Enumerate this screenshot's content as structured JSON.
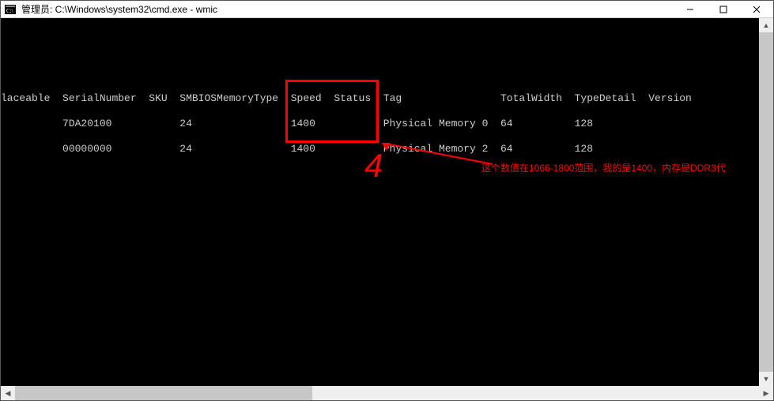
{
  "window": {
    "title": "管理员: C:\\Windows\\system32\\cmd.exe - wmic"
  },
  "headers": {
    "laceable": "laceable",
    "serial": "SerialNumber",
    "sku": "SKU",
    "smbios": "SMBIOSMemoryType",
    "speed": "Speed",
    "status": "Status",
    "tag": "Tag",
    "totalwidth": "TotalWidth",
    "typedetail": "TypeDetail",
    "version": "Version"
  },
  "rows": [
    {
      "serial": "7DA20100",
      "sku": "",
      "smbios": "24",
      "speed": "1400",
      "status": "",
      "tag": "Physical Memory 0",
      "totalwidth": "64",
      "typedetail": "128",
      "version": ""
    },
    {
      "serial": "00000000",
      "sku": "",
      "smbios": "24",
      "speed": "1400",
      "status": "",
      "tag": "Physical Memory 2",
      "totalwidth": "64",
      "typedetail": "128",
      "version": ""
    }
  ],
  "annotation": {
    "indicator": "4",
    "note": "这个数值在1066-1800范围，我的是1400，内存是DDR3代"
  }
}
